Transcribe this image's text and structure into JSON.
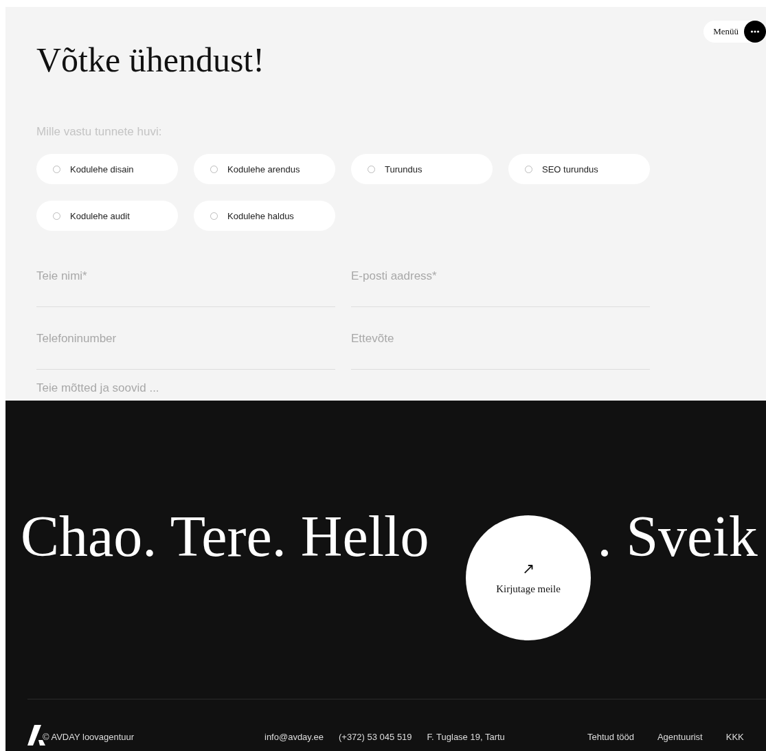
{
  "menu": {
    "label": "Menüü"
  },
  "heading": "Võtke ühendust!",
  "interest": {
    "label": "Mille vastu tunnete huvi:",
    "options": [
      {
        "label": "Kodulehe disain",
        "selected": false
      },
      {
        "label": "Kodulehe arendus",
        "selected": false
      },
      {
        "label": "Turundus",
        "selected": false
      },
      {
        "label": "SEO turundus",
        "selected": false
      },
      {
        "label": "Kodulehe audit",
        "selected": false
      },
      {
        "label": "Kodulehe haldus",
        "selected": false
      }
    ]
  },
  "fields": [
    {
      "placeholder": "Teie nimi*"
    },
    {
      "placeholder": "E-posti aadress*"
    },
    {
      "placeholder": "Telefoninumber"
    },
    {
      "placeholder": "Ettevõte"
    }
  ],
  "message": {
    "placeholder": "Teie mõtted ja soovid ..."
  },
  "greeting": {
    "left": "Chao. Tere. Hello",
    "right": ". Sveik"
  },
  "cta": {
    "icon": "↗",
    "label": "Kirjutage meile"
  },
  "footer": {
    "copyright": "© AVDAY loovagentuur",
    "contacts": [
      "info@avday.ee",
      "(+372) 53 045 519",
      "F. Tuglase 19, Tartu"
    ],
    "links": [
      "Tehtud tööd",
      "Agentuurist",
      "KKK"
    ]
  }
}
